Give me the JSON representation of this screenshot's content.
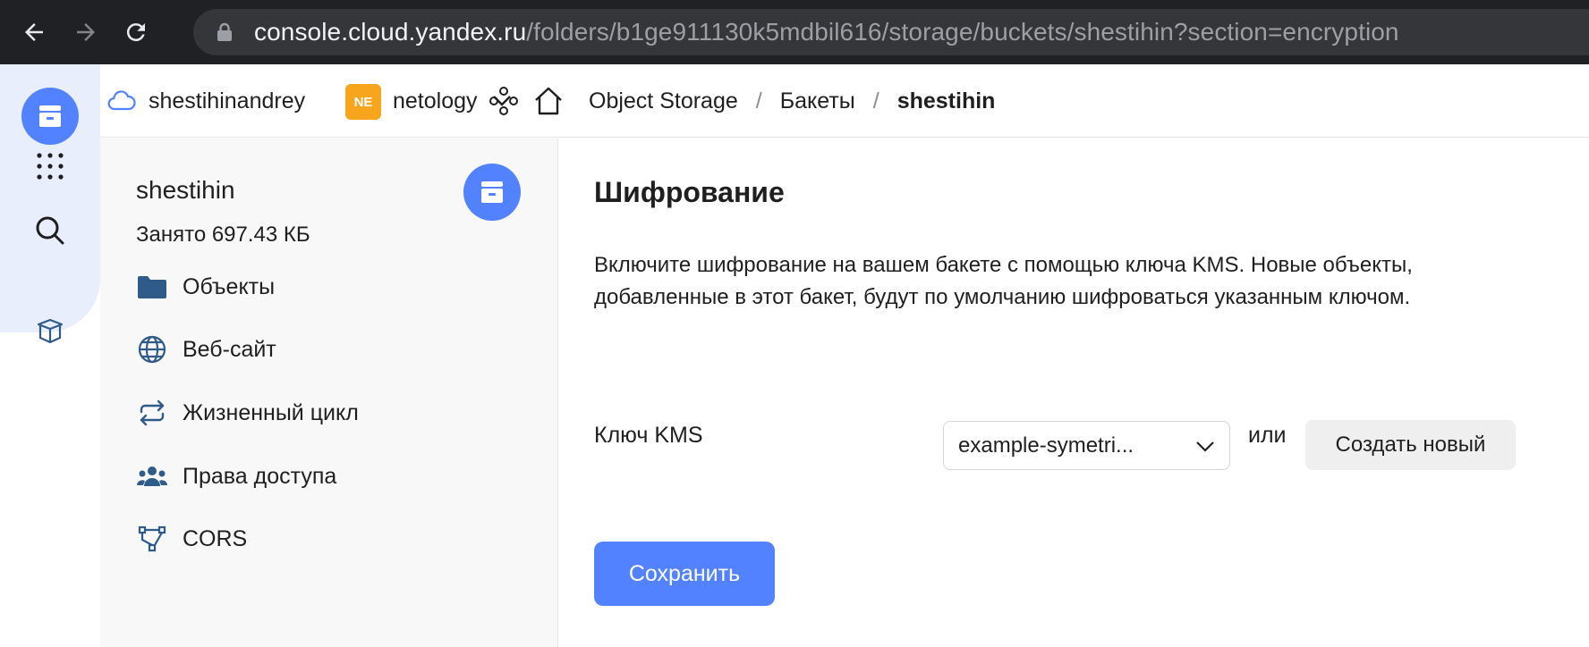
{
  "browser": {
    "url_host": "console.cloud.yandex.ru",
    "url_path": "/folders/b1ge911130k5mdbil616/storage/buckets/shestihin?section=encryption",
    "icons": [
      "back-arrow-icon",
      "forward-arrow-icon",
      "reload-icon",
      "lock-icon"
    ]
  },
  "rail": {
    "icons": [
      "storage-bucket-icon",
      "apps-grid-icon",
      "search-icon",
      "box-icon"
    ],
    "accent": "#5282ff"
  },
  "topbar": {
    "cloud_name": "shestihinandrey",
    "folder_badge": "NE",
    "folder_name": "netology",
    "breadcrumbs": [
      "Object Storage",
      "Бакеты",
      "shestihin"
    ],
    "separator": "/"
  },
  "sidebar": {
    "bucket_name": "shestihin",
    "bucket_used": "Занято 697.43 КБ",
    "items": [
      {
        "label": "Объекты",
        "icon": "folder-icon"
      },
      {
        "label": "Веб-сайт",
        "icon": "globe-icon"
      },
      {
        "label": "Жизненный цикл",
        "icon": "lifecycle-icon"
      },
      {
        "label": "Права доступа",
        "icon": "users-icon"
      },
      {
        "label": "CORS",
        "icon": "cors-icon"
      }
    ]
  },
  "main": {
    "title": "Шифрование",
    "description": "Включите шифрование на вашем бакете с помощью ключа KMS. Новые объекты, добавленные в этот бакет, будут по умолчанию шифроваться указанным ключом.",
    "kms_label": "Ключ KMS",
    "kms_selected": "example-symetri...",
    "or_text": "или",
    "create_label": "Создать новый",
    "save_label": "Сохранить"
  },
  "colors": {
    "primary": "#5282ff",
    "badge": "#f7a51d",
    "chrome_bg": "#202124"
  }
}
